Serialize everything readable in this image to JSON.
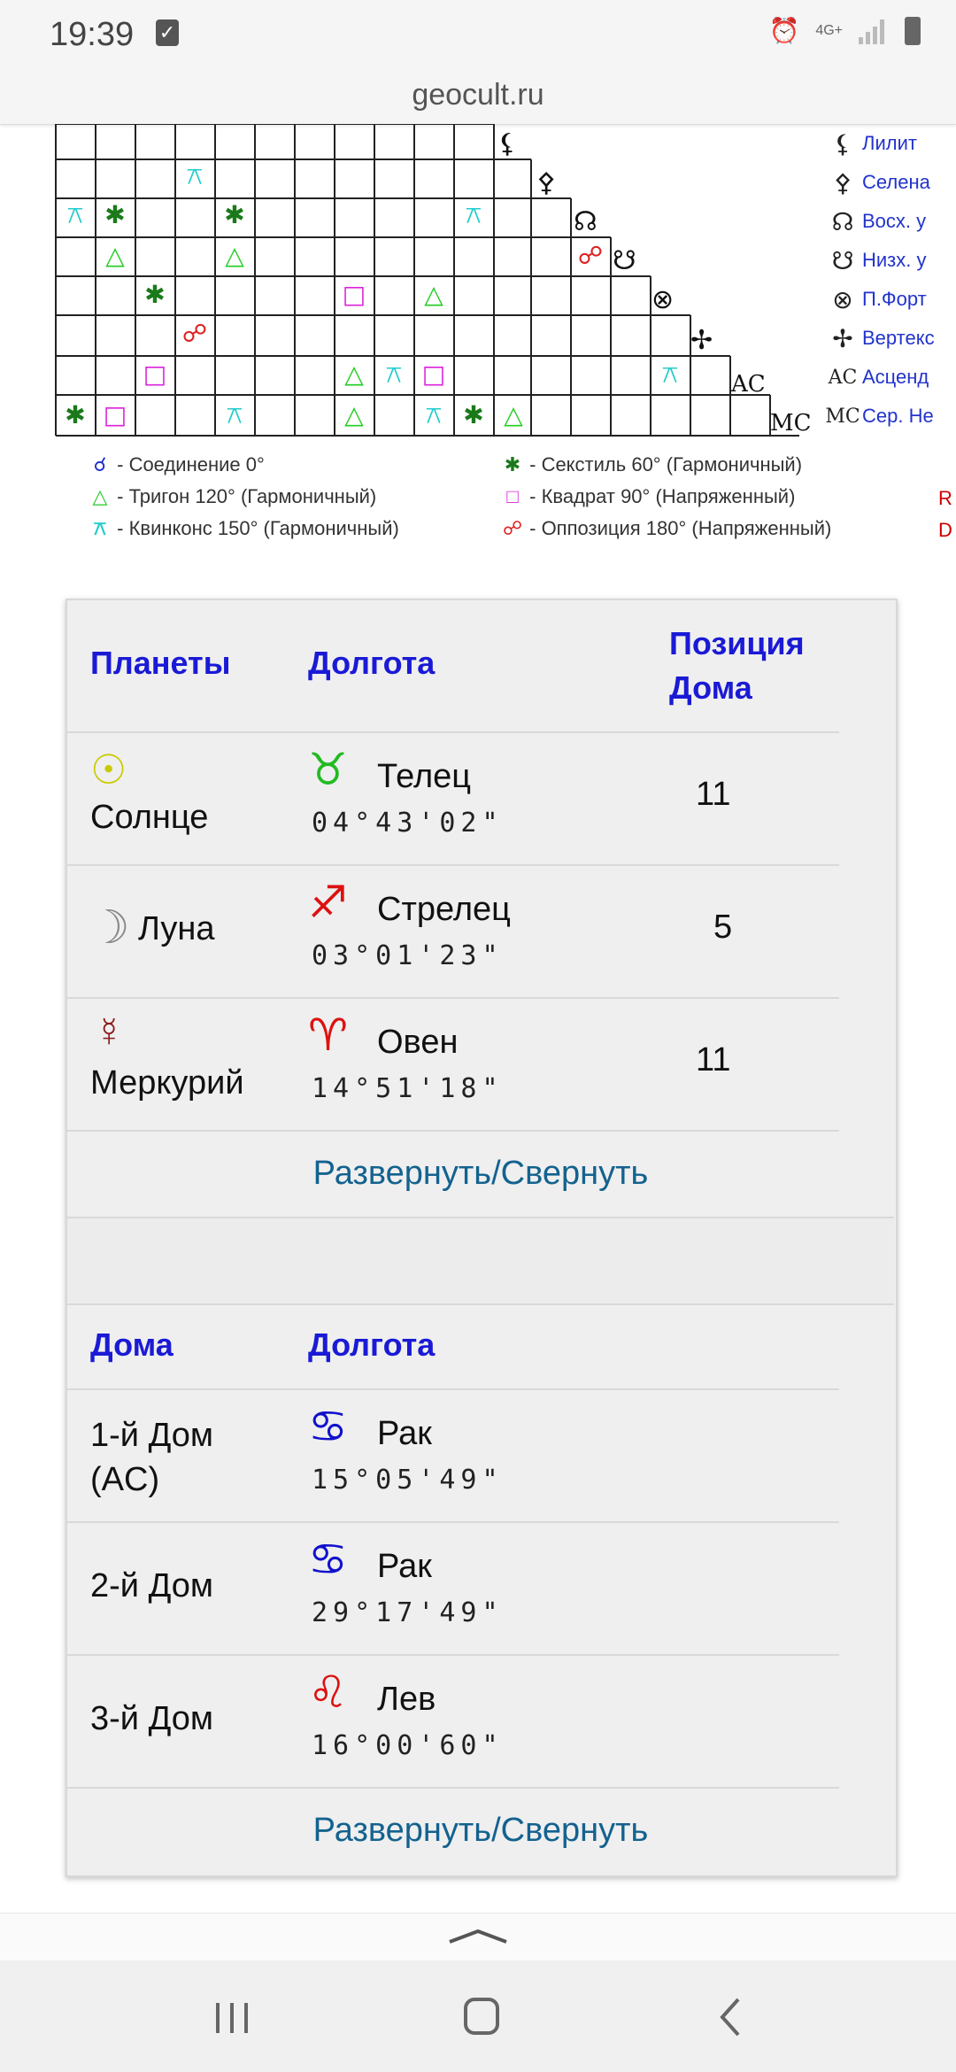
{
  "status_bar": {
    "time": "19:39",
    "network": "4G+"
  },
  "browser": {
    "url": "geocult.ru"
  },
  "aspect_grid": {
    "corner_labels": [
      "AC",
      "MC"
    ],
    "planet_legend": [
      {
        "icon": "lilith-icon",
        "glyph": "⚸",
        "label": "Лилит"
      },
      {
        "icon": "selena-icon",
        "glyph": "⚴",
        "label": "Селена"
      },
      {
        "icon": "north-node-icon",
        "glyph": "☊",
        "label": "Восх. у"
      },
      {
        "icon": "south-node-icon",
        "glyph": "☋",
        "label": "Низх. у"
      },
      {
        "icon": "fortune-icon",
        "glyph": "⊗",
        "label": "П.Форт"
      },
      {
        "icon": "vertex-icon",
        "glyph": "✢",
        "label": "Вертекс"
      },
      {
        "icon": "ascendant-icon",
        "glyph": "AC",
        "label": "Асценд"
      },
      {
        "icon": "midheaven-icon",
        "glyph": "MC",
        "label": "Сер. Не"
      }
    ],
    "aspect_legend": [
      {
        "glyph": "☌",
        "color": "#2233cc",
        "label": "- Соединение 0°"
      },
      {
        "glyph": "✱",
        "color": "#1a7a1a",
        "label": "- Секстиль 60° (Гармоничный)"
      },
      {
        "glyph": "△",
        "color": "#22cc22",
        "label": "- Тригон 120° (Гармоничный)"
      },
      {
        "glyph": "□",
        "color": "#dd22dd",
        "label": "- Квадрат 90° (Напряженный)"
      },
      {
        "glyph": "⚻",
        "color": "#22cccc",
        "label": "- Квинконс 150° (Гармоничный)"
      },
      {
        "glyph": "☍",
        "color": "#dd2222",
        "label": "- Оппозиция 180° (Напряженный)"
      }
    ],
    "edge_letters": [
      "R",
      "D"
    ]
  },
  "planets_table": {
    "headers": {
      "name": "Планеты",
      "longitude": "Долгота",
      "house": "Позиция Дома"
    },
    "rows": [
      {
        "glyph": "☉",
        "glyph_color": "#c9c900",
        "name": "Солнце",
        "sign_glyph": "♉",
        "sign_color": "#22bb22",
        "sign": "Телец",
        "degree": "04°43'02\"",
        "house": "11"
      },
      {
        "glyph": "☽",
        "glyph_color": "#888888",
        "name": "Луна",
        "sign_glyph": "♐",
        "sign_color": "#dd1111",
        "sign": "Стрелец",
        "degree": "03°01'23\"",
        "house": "5"
      },
      {
        "glyph": "☿",
        "glyph_color": "#8b1a1a",
        "name": "Меркурий",
        "sign_glyph": "♈",
        "sign_color": "#dd1111",
        "sign": "Овен",
        "degree": "14°51'18\"",
        "house": "11"
      }
    ],
    "toggle_label": "Развернуть/Свернуть"
  },
  "houses_table": {
    "headers": {
      "name": "Дома",
      "longitude": "Долгота"
    },
    "rows": [
      {
        "name": "1-й Дом (AC)",
        "sign_glyph": "♋",
        "sign_color": "#1111cc",
        "sign": "Рак",
        "degree": "15°05'49\""
      },
      {
        "name": "2-й Дом",
        "sign_glyph": "♋",
        "sign_color": "#1111cc",
        "sign": "Рак",
        "degree": "29°17'49\""
      },
      {
        "name": "3-й Дом",
        "sign_glyph": "♌",
        "sign_color": "#dd1111",
        "sign": "Лев",
        "degree": "16°00'60\""
      }
    ],
    "toggle_label": "Развернуть/Свернуть"
  }
}
